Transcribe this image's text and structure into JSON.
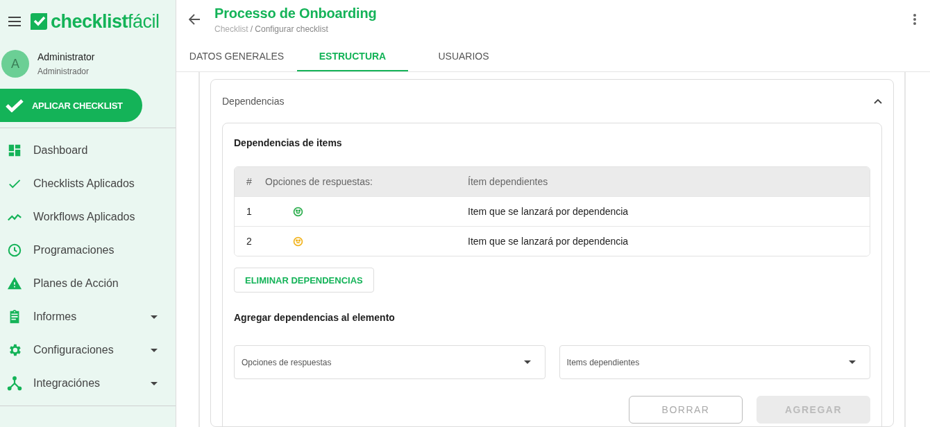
{
  "sidebar": {
    "logo": "**checklist**fácil",
    "user": {
      "initial": "A",
      "name": "Administrator",
      "role": "Administrador"
    },
    "apply_button": "APLICAR CHECKLIST",
    "items": [
      {
        "label": "Dashboard",
        "kind": "dashboard",
        "expandable": false
      },
      {
        "label": "Checklists Aplicados",
        "kind": "check",
        "expandable": false
      },
      {
        "label": "Workflows Aplicados",
        "kind": "trend",
        "expandable": false
      },
      {
        "label": "Programaciones",
        "kind": "clock",
        "expandable": false
      },
      {
        "label": "Planes de Acción",
        "kind": "warning",
        "expandable": false
      },
      {
        "label": "Informes",
        "kind": "clipboard",
        "expandable": true
      },
      {
        "label": "Configuraciones",
        "kind": "gear",
        "expandable": true
      },
      {
        "label": "Integraciónes",
        "kind": "hub",
        "expandable": true
      }
    ]
  },
  "header": {
    "title": "Processo de Onboarding",
    "breadcrumb": [
      "Checklist",
      "/ Configurar checklist"
    ]
  },
  "tabs": [
    {
      "label": "DATOS GENERALES",
      "selected": false
    },
    {
      "label": "ESTRUCTURA",
      "selected": true
    },
    {
      "label": "USUARIOS",
      "selected": false
    }
  ],
  "section": {
    "title": "Dependencias",
    "expanded": true,
    "card_title": "Dependencias de items",
    "table": {
      "columns": [
        "#",
        "Opciones de respuestas:",
        "Ítem dependientes"
      ],
      "rows": [
        {
          "number": "1",
          "option": {
            "kind": "happy",
            "color": "#2eae4f"
          },
          "item": "Item que se lanzará por dependencia"
        },
        {
          "number": "2",
          "option": {
            "kind": "neutral",
            "color": "#f2b522"
          },
          "item": "Item que se lanzará por dependencia"
        }
      ]
    },
    "remove_button": "ELIMINAR DEPENDENCIAS",
    "add_title": "Agregar dependencias al elemento",
    "selects": [
      {
        "placeholder": "Opciones de respuestas"
      },
      {
        "placeholder": "Items dependientes"
      }
    ],
    "buttons": [
      {
        "label": "BORRAR",
        "disabled": false
      },
      {
        "label": "AGREGAR",
        "disabled": true
      }
    ]
  }
}
